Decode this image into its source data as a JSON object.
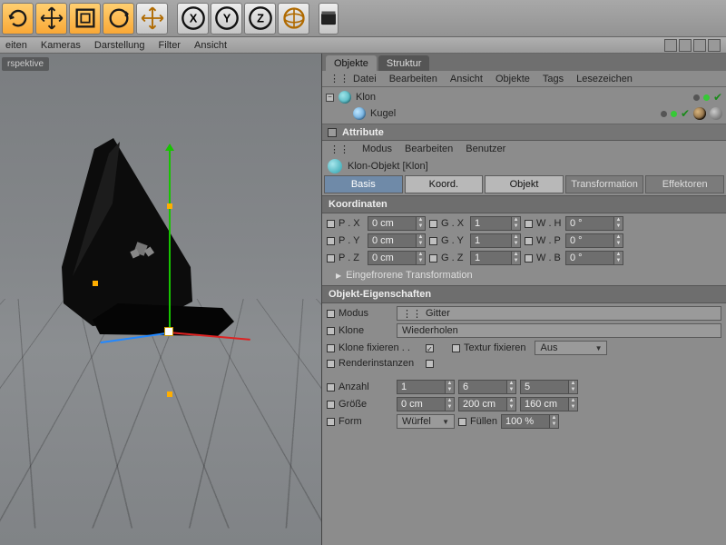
{
  "toolbar_menu": [
    "eiten",
    "Kameras",
    "Darstellung",
    "Filter",
    "Ansicht"
  ],
  "viewport_label": "rspektive",
  "panel_tabs": {
    "objects": "Objekte",
    "structure": "Struktur"
  },
  "panel_menu": [
    "Datei",
    "Bearbeiten",
    "Ansicht",
    "Objekte",
    "Tags",
    "Lesezeichen"
  ],
  "tree": {
    "klon": "Klon",
    "kugel": "Kugel"
  },
  "attr_title": "Attribute",
  "attr_menu": [
    "Modus",
    "Bearbeiten",
    "Benutzer"
  ],
  "attr_obj": "Klon-Objekt [Klon]",
  "atabs": {
    "basis": "Basis",
    "koord": "Koord.",
    "objekt": "Objekt",
    "transform": "Transformation",
    "effekt": "Effektoren"
  },
  "sect": {
    "koord": "Koordinaten",
    "frozen": "Eingefrorene Transformation",
    "objprop": "Objekt-Eigenschaften"
  },
  "coords": {
    "px": {
      "l": "P . X",
      "v": "0 cm"
    },
    "gx": {
      "l": "G . X",
      "v": "1"
    },
    "wh": {
      "l": "W . H",
      "v": "0 °"
    },
    "py": {
      "l": "P . Y",
      "v": "0 cm"
    },
    "gy": {
      "l": "G . Y",
      "v": "1"
    },
    "wp": {
      "l": "W . P",
      "v": "0 °"
    },
    "pz": {
      "l": "P . Z",
      "v": "0 cm"
    },
    "gz": {
      "l": "G . Z",
      "v": "1"
    },
    "wb": {
      "l": "W . B",
      "v": "0 °"
    }
  },
  "obj": {
    "modus_l": "Modus",
    "modus_v": "Gitter",
    "klone_l": "Klone",
    "klone_v": "Wiederholen",
    "klonefix_l": "Klone fixieren . .",
    "texfix_l": "Textur fixieren",
    "texfix_v": "Aus",
    "render_l": "Renderinstanzen",
    "anzahl_l": "Anzahl",
    "anzahl_v": [
      "1",
      "6",
      "5"
    ],
    "groesse_l": "Größe",
    "groesse_v": [
      "0 cm",
      "200 cm",
      "160 cm"
    ],
    "form_l": "Form",
    "form_v": "Würfel",
    "fuellen_l": "Füllen",
    "fuellen_v": "100 %"
  }
}
